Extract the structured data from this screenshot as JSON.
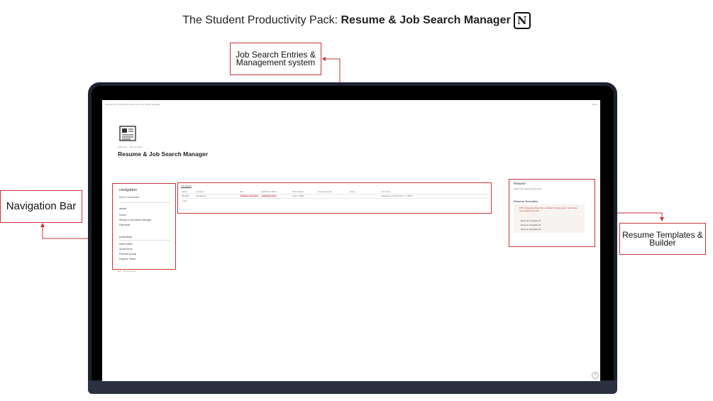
{
  "heading": {
    "prefix": "The  Student Productivity Pack: ",
    "emphasis": "Resume & Job Search Manager",
    "logo_letter": "N"
  },
  "callouts": {
    "job_search_line1": "Job Search Entries &",
    "job_search_line2": "Management system",
    "navigation": "Navigation Bar",
    "resume_line1": "Resume Templates &",
    "resume_line2": "Builder"
  },
  "screen": {
    "breadcrumb": "Resume Kit  /  Dashboard  /  Resume & Job Search Manager",
    "topbar_right": "Share",
    "page_meta": "Add cover · Add comment",
    "page_title": "Resume & Job Search Manager",
    "nav": {
      "heading": "navigation",
      "back": "Back to Dashboard",
      "section_school": "school",
      "school_items": [
        "School",
        "Resume & Job Search Manager",
        "Flashcards"
      ],
      "section_productivity": "productivity",
      "productivity_items": [
        "Habit Tracker",
        "Quotes Book",
        "Personal Journal",
        "Expense Tracker"
      ]
    },
    "footer_note": "jam · 19 comments",
    "db": {
      "tab": "Job Search",
      "columns": [
        "Status",
        "Company",
        "Role",
        "Application Status",
        "Date Applied",
        "Job posting link",
        "Notes",
        "Comments"
      ],
      "row": [
        "Pending",
        "Company A",
        "Software Developer",
        "Application Sent",
        "June 1, 2023",
        "",
        "",
        "Interview on 2 June from 2 - 4 PM in..."
      ],
      "new_label": "+ New"
    },
    "resume": {
      "heading": "Resume",
      "subtext": "Insert your main resume here",
      "templates_heading": "Resume Templates",
      "tip": "TIP!! Change the Page title to a Book by hitting space. It will make the template look nicer",
      "templates": [
        "Resume Template #1",
        "Resume Template #2",
        "Resume Template #3"
      ]
    },
    "help": "?"
  },
  "colors": {
    "accent_red": "#c7343a",
    "laptop_frame": "#1d2230"
  }
}
